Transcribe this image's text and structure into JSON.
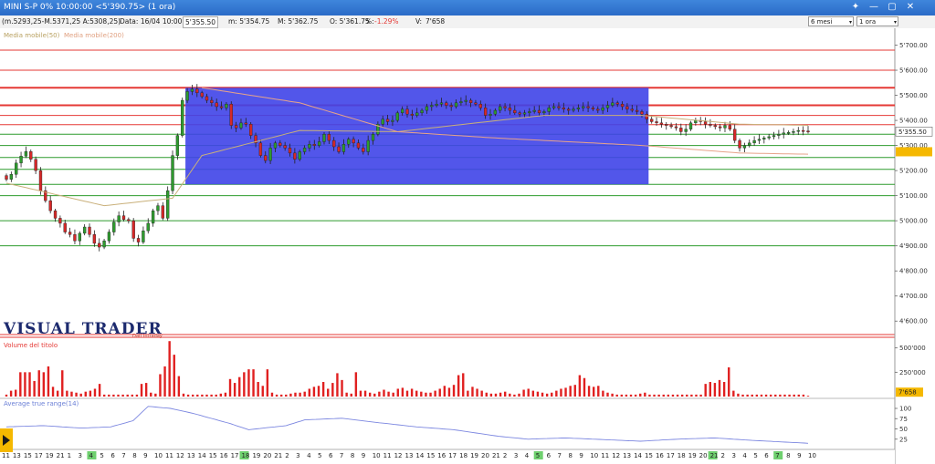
{
  "window": {
    "title": "MINI S-P 0%  10:00:00   <5'390.75>  (1 ora)",
    "controls": {
      "pin": "✕",
      "minimize": "—",
      "maximize": "▢",
      "close": "✕"
    },
    "timeframe_options": {
      "period": "6 mesi",
      "interval": "1 ora"
    }
  },
  "infobar": {
    "range": "(m.5293,25-M.5371,25 A:5308,25)",
    "date": "Data: 16/04 10:00:00",
    "last": "5'355.50",
    "min": "m: 5'354.75",
    "max": "M: 5'362.75",
    "open": "O: 5'361.75",
    "change_label": "%:",
    "change": "-1.29%",
    "volume_label": "V:",
    "volume": "7'658"
  },
  "panels": {
    "price": {
      "legend": [
        "Media mobile(50)",
        "Media mobile(200)"
      ],
      "watermark": "VISUAL TRADER",
      "watermark_sub": "Dati Intraday"
    },
    "volume": {
      "legend": "Volume del titolo",
      "last_label": "7'658"
    },
    "atr": {
      "legend": "Average true range(14)"
    }
  },
  "chart_data": {
    "type": "candlestick",
    "y_axis_price": {
      "ylim": [
        4550,
        5760
      ],
      "ticks": [
        "5'700.00",
        "5'600.00",
        "5'500.00",
        "5'400.00",
        "5'300.00",
        "5'200.00",
        "5'100.00",
        "5'000.00",
        "4'900.00",
        "4'800.00",
        "4'700.00",
        "4'600.00"
      ],
      "tick_values": [
        5700,
        5600,
        5500,
        5400,
        5300,
        5200,
        5100,
        5000,
        4900,
        4800,
        4700,
        4600
      ],
      "last_price_label": "5'355.50",
      "last_price": 5355.5,
      "orange_label_value": 5275
    },
    "y_axis_volume": {
      "ylim": [
        0,
        600000
      ],
      "ticks": [
        "500'000",
        "250'000"
      ],
      "tick_values": [
        500000,
        250000
      ]
    },
    "y_axis_atr": {
      "ylim": [
        0,
        120
      ],
      "ticks": [
        "100",
        "75",
        "50",
        "25"
      ],
      "tick_values": [
        100,
        75,
        50,
        25
      ]
    },
    "x_labels": [
      "11",
      "13",
      "15",
      "17",
      "19",
      "21",
      "1",
      "3",
      "4",
      "5",
      "6",
      "7",
      "8",
      "9",
      "10",
      "11",
      "12",
      "13",
      "14",
      "15",
      "16",
      "17",
      "18",
      "19",
      "20",
      "21",
      "2",
      "3",
      "4",
      "5",
      "6",
      "7",
      "8",
      "9",
      "10",
      "11",
      "12",
      "13",
      "14",
      "15",
      "16",
      "17",
      "18",
      "19",
      "20",
      "21",
      "2",
      "3",
      "4",
      "5",
      "6",
      "7",
      "8",
      "9",
      "10",
      "11",
      "12",
      "13",
      "14",
      "15",
      "16",
      "17",
      "18",
      "19",
      "20",
      "21",
      "2",
      "3",
      "4",
      "5",
      "6",
      "7",
      "8",
      "9",
      "10"
    ],
    "x_markers": [
      "8",
      "10",
      "14",
      "15",
      "17"
    ],
    "horizontal_levels": [
      {
        "value": 5680,
        "color": "#e53935",
        "width": 1
      },
      {
        "value": 5600,
        "color": "#e53935",
        "width": 1
      },
      {
        "value": 5530,
        "color": "#e53935",
        "width": 2
      },
      {
        "value": 5460,
        "color": "#e53935",
        "width": 2
      },
      {
        "value": 5420,
        "color": "#e53935",
        "width": 1
      },
      {
        "value": 5383,
        "color": "#e53935",
        "width": 1
      },
      {
        "value": 5345,
        "color": "#2e9b2e",
        "width": 1
      },
      {
        "value": 5300,
        "color": "#2e9b2e",
        "width": 1
      },
      {
        "value": 5252,
        "color": "#2e9b2e",
        "width": 1
      },
      {
        "value": 5205,
        "color": "#2e9b2e",
        "width": 1
      },
      {
        "value": 5145,
        "color": "#2e9b2e",
        "width": 1
      },
      {
        "value": 5100,
        "color": "#2e9b2e",
        "width": 1
      },
      {
        "value": 5000,
        "color": "#2e9b2e",
        "width": 1
      },
      {
        "value": 4900,
        "color": "#2e9b2e",
        "width": 1
      }
    ],
    "range_box": {
      "start_index": 37,
      "end_index": 131,
      "high": 5530,
      "low": 5145,
      "color": "#3f44e8"
    },
    "closes": [
      5165,
      5185,
      5230,
      5258,
      5276,
      5245,
      5200,
      5120,
      5080,
      5040,
      5010,
      4990,
      4955,
      4945,
      4920,
      4950,
      4975,
      4945,
      4910,
      4895,
      4920,
      4955,
      4995,
      5020,
      5005,
      5000,
      4930,
      4915,
      4960,
      4990,
      5040,
      5060,
      5010,
      5120,
      5260,
      5340,
      5480,
      5515,
      5525,
      5510,
      5495,
      5480,
      5470,
      5455,
      5450,
      5465,
      5380,
      5370,
      5390,
      5385,
      5340,
      5310,
      5260,
      5240,
      5290,
      5310,
      5300,
      5290,
      5270,
      5245,
      5275,
      5290,
      5305,
      5300,
      5315,
      5345,
      5320,
      5295,
      5275,
      5305,
      5325,
      5310,
      5290,
      5275,
      5320,
      5345,
      5385,
      5405,
      5395,
      5400,
      5430,
      5445,
      5425,
      5420,
      5430,
      5440,
      5455,
      5460,
      5465,
      5470,
      5460,
      5455,
      5470,
      5475,
      5480,
      5470,
      5465,
      5450,
      5420,
      5425,
      5440,
      5455,
      5450,
      5440,
      5430,
      5425,
      5430,
      5435,
      5440,
      5430,
      5435,
      5450,
      5455,
      5450,
      5445,
      5440,
      5445,
      5450,
      5455,
      5450,
      5445,
      5440,
      5450,
      5460,
      5470,
      5465,
      5455,
      5445,
      5440,
      5435,
      5425,
      5405,
      5395,
      5390,
      5385,
      5380,
      5375,
      5370,
      5355,
      5365,
      5390,
      5400,
      5395,
      5385,
      5380,
      5375,
      5370,
      5380,
      5365,
      5320,
      5290,
      5300,
      5310,
      5320,
      5325,
      5330,
      5335,
      5340,
      5345,
      5350,
      5352,
      5356,
      5360,
      5358,
      5355.5
    ],
    "ma50_anchors": [
      [
        0,
        5150
      ],
      [
        20,
        5060
      ],
      [
        34,
        5090
      ],
      [
        40,
        5260
      ],
      [
        60,
        5360
      ],
      [
        80,
        5355
      ],
      [
        110,
        5420
      ],
      [
        130,
        5420
      ],
      [
        150,
        5385
      ],
      [
        165,
        5380
      ]
    ],
    "ma200_anchors": [
      [
        40,
        5530
      ],
      [
        60,
        5470
      ],
      [
        80,
        5355
      ],
      [
        100,
        5330
      ],
      [
        130,
        5300
      ],
      [
        150,
        5270
      ],
      [
        165,
        5265
      ]
    ],
    "volume_values": [
      20000,
      60000,
      70000,
      250000,
      250000,
      250000,
      160000,
      270000,
      250000,
      310000,
      100000,
      60000,
      270000,
      60000,
      50000,
      40000,
      30000,
      50000,
      60000,
      80000,
      130000,
      20000,
      20000,
      20000,
      20000,
      20000,
      20000,
      20000,
      20000,
      130000,
      140000,
      40000,
      30000,
      230000,
      310000,
      570000,
      430000,
      210000,
      30000,
      20000,
      20000,
      20000,
      20000,
      20000,
      20000,
      20000,
      30000,
      40000,
      180000,
      140000,
      200000,
      250000,
      280000,
      280000,
      150000,
      110000,
      280000,
      40000,
      20000,
      20000,
      20000,
      30000,
      40000,
      40000,
      50000,
      80000,
      100000,
      110000,
      150000,
      80000,
      140000,
      240000,
      170000,
      40000,
      30000,
      250000,
      60000,
      60000,
      40000,
      30000,
      50000,
      70000,
      50000,
      40000,
      80000,
      90000,
      60000,
      80000,
      60000,
      50000,
      40000,
      40000,
      60000,
      80000,
      110000,
      90000,
      120000,
      220000,
      240000,
      60000,
      100000,
      80000,
      60000,
      40000,
      30000,
      30000,
      40000,
      50000,
      30000,
      20000,
      30000,
      70000,
      80000,
      60000,
      50000,
      40000,
      30000,
      40000,
      60000,
      80000,
      90000,
      110000,
      120000,
      220000,
      190000,
      110000,
      100000,
      110000,
      60000,
      40000,
      30000,
      20000,
      20000,
      20000,
      20000,
      20000,
      30000,
      40000,
      20000,
      20000,
      20000,
      20000,
      20000,
      20000,
      20000,
      20000,
      20000,
      20000,
      20000,
      20000,
      130000,
      150000,
      140000,
      170000,
      150000,
      300000,
      60000,
      30000,
      20000,
      20000,
      20000,
      20000,
      20000,
      20000,
      20000,
      20000,
      20000,
      20000,
      20000,
      20000,
      20000,
      20000,
      7658
    ],
    "atr_anchors": [
      [
        0,
        55
      ],
      [
        10,
        58
      ],
      [
        20,
        52
      ],
      [
        28,
        55
      ],
      [
        34,
        70
      ],
      [
        38,
        105
      ],
      [
        44,
        100
      ],
      [
        50,
        88
      ],
      [
        60,
        63
      ],
      [
        65,
        48
      ],
      [
        75,
        58
      ],
      [
        80,
        72
      ],
      [
        90,
        76
      ],
      [
        100,
        65
      ],
      [
        110,
        55
      ],
      [
        120,
        48
      ],
      [
        132,
        32
      ],
      [
        140,
        25
      ],
      [
        150,
        28
      ],
      [
        160,
        24
      ],
      [
        170,
        20
      ],
      [
        180,
        25
      ],
      [
        190,
        28
      ],
      [
        200,
        22
      ],
      [
        215,
        15
      ]
    ]
  }
}
